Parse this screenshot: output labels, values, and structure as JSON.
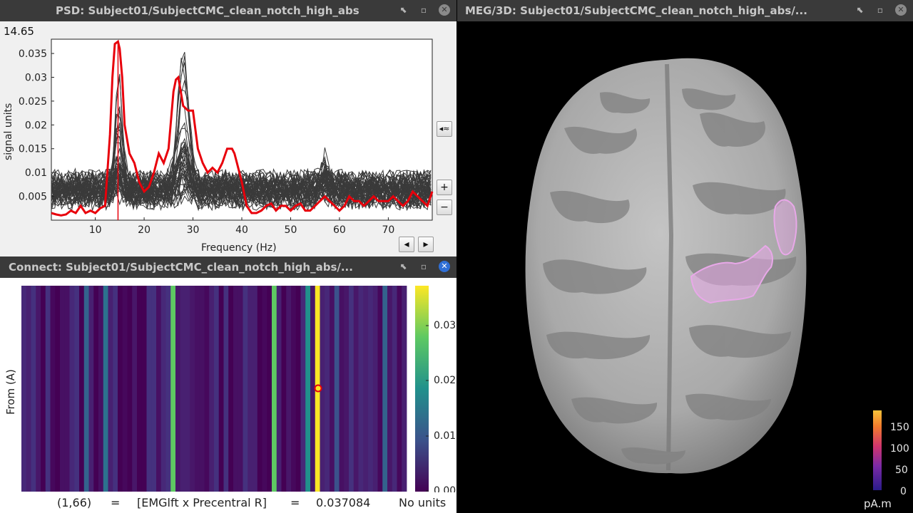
{
  "psd": {
    "title": "PSD: Subject01/SubjectCMC_clean_notch_high_abs",
    "cursor_value": "14.65",
    "ylabel": "signal units",
    "xlabel": "Frequency (Hz)",
    "yticks": [
      "0.005",
      "0.01",
      "0.015",
      "0.02",
      "0.025",
      "0.03",
      "0.035"
    ],
    "xticks": [
      "10",
      "20",
      "30",
      "40",
      "50",
      "60",
      "70"
    ],
    "buttons": {
      "spectrum": "◂≈",
      "zoom_in": "+",
      "zoom_out": "−",
      "prev": "◂",
      "next": "▸"
    }
  },
  "conn": {
    "title": "Connect: Subject01/SubjectCMC_clean_notch_high_abs/...",
    "ylabel": "From (A)",
    "colorbar_ticks": [
      "0.03",
      "0.02",
      "0.01",
      "0.00"
    ],
    "status": {
      "index": "(1,66)",
      "eq1": "=",
      "pair": "[EMGlft x Precentral R]",
      "eq2": "=",
      "value": "0.037084",
      "units": "No units"
    }
  },
  "meg": {
    "title": "MEG/3D: Subject01/SubjectCMC_clean_notch_high_abs/...",
    "colorbar_ticks": [
      "150",
      "100",
      "50",
      "0"
    ],
    "units": "pA.m"
  },
  "window_buttons": {
    "undock": "⬉",
    "minimize": "▫",
    "close": "✕"
  },
  "colors": {
    "highlight_trace": "#e8000b",
    "traces": "#3a3a3a",
    "roi": "#e8a8e8",
    "panel_bg": "#f0f0f0"
  },
  "chart_data": {
    "type": "line",
    "xlabel": "Frequency (Hz)",
    "ylabel": "signal units",
    "xlim": [
      1,
      79
    ],
    "ylim": [
      0,
      0.038
    ],
    "cursor_x": 14.65,
    "series": [
      {
        "x": [
          1,
          2,
          3,
          4,
          5,
          6,
          7,
          8,
          9,
          10,
          11,
          12,
          13,
          13.5,
          14,
          14.65,
          15,
          15.5,
          16,
          17,
          18,
          19,
          20,
          21,
          22,
          23,
          24,
          25,
          26,
          26.5,
          27,
          27.5,
          28,
          29,
          30,
          31,
          32,
          33,
          34,
          35,
          36,
          37,
          38,
          38.5,
          39,
          40,
          41,
          42,
          43,
          44,
          45,
          46,
          47,
          48,
          49,
          50,
          51,
          52,
          53,
          54,
          55,
          56,
          57,
          58,
          59,
          60,
          61,
          62,
          63,
          64,
          65,
          66,
          67,
          68,
          69,
          70,
          71,
          72,
          73,
          74,
          75,
          76,
          77,
          78,
          79
        ],
        "y": [
          0.0015,
          0.0012,
          0.001,
          0.0012,
          0.002,
          0.0015,
          0.003,
          0.0015,
          0.002,
          0.0015,
          0.0025,
          0.003,
          0.018,
          0.03,
          0.037,
          0.0375,
          0.036,
          0.03,
          0.02,
          0.014,
          0.012,
          0.008,
          0.006,
          0.007,
          0.01,
          0.014,
          0.012,
          0.015,
          0.027,
          0.0295,
          0.03,
          0.027,
          0.024,
          0.023,
          0.023,
          0.015,
          0.012,
          0.01,
          0.011,
          0.01,
          0.012,
          0.015,
          0.015,
          0.014,
          0.012,
          0.008,
          0.003,
          0.0015,
          0.0015,
          0.002,
          0.003,
          0.0035,
          0.002,
          0.003,
          0.003,
          0.002,
          0.003,
          0.0035,
          0.002,
          0.002,
          0.003,
          0.004,
          0.005,
          0.004,
          0.003,
          0.002,
          0.003,
          0.005,
          0.004,
          0.004,
          0.003,
          0.004,
          0.005,
          0.004,
          0.004,
          0.004,
          0.005,
          0.004,
          0.003,
          0.004,
          0.006,
          0.005,
          0.004,
          0.003,
          0.006
        ]
      }
    ]
  }
}
